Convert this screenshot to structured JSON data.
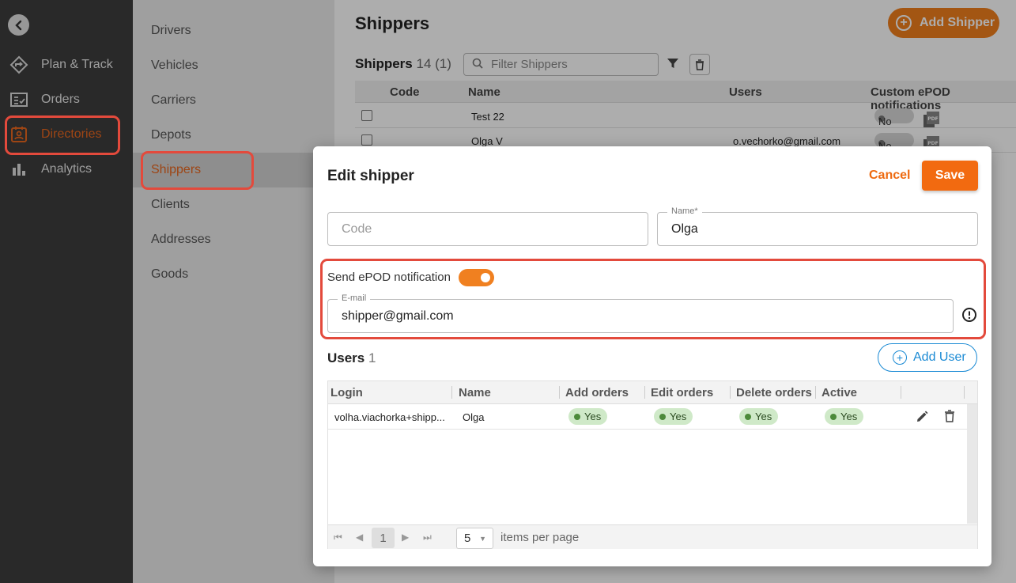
{
  "nav": {
    "items": [
      {
        "label": "Plan & Track",
        "icon": "route-icon"
      },
      {
        "label": "Orders",
        "icon": "orders-icon"
      },
      {
        "label": "Directories",
        "icon": "contacts-icon"
      },
      {
        "label": "Analytics",
        "icon": "bar-chart-icon"
      }
    ]
  },
  "subnav": {
    "items": [
      "Drivers",
      "Vehicles",
      "Carriers",
      "Depots",
      "Shippers",
      "Clients",
      "Addresses",
      "Goods"
    ]
  },
  "main": {
    "title": "Shippers",
    "add_label": "Add Shipper",
    "list_title": "Shippers",
    "list_count": "14 (1)",
    "filter_placeholder": "Filter Shippers",
    "columns": [
      "Code",
      "Name",
      "Users",
      "Custom ePOD notifications"
    ],
    "rows": [
      {
        "code": "",
        "name": "Test 22",
        "users": "",
        "epod": "No",
        "pdf": "PDF"
      },
      {
        "code": "",
        "name": "Olga V",
        "users": "o.vechorko@gmail.com",
        "epod": "No",
        "pdf": "PDF"
      }
    ]
  },
  "modal": {
    "title": "Edit shipper",
    "cancel_label": "Cancel",
    "save_label": "Save",
    "code_placeholder": "Code",
    "name_label": "Name*",
    "name_value": "Olga",
    "epod_label": "Send ePOD notification",
    "epod_on": true,
    "email_label": "E-mail",
    "email_value": "shipper@gmail.com",
    "users_title": "Users",
    "users_count": "1",
    "add_user_label": "Add User",
    "user_columns": [
      "Login",
      "Name",
      "Add orders",
      "Edit orders",
      "Delete orders",
      "Active"
    ],
    "users": [
      {
        "login": "volha.viachorka+shipp...",
        "name": "Olga",
        "add": "Yes",
        "edit": "Yes",
        "delete": "Yes",
        "active": "Yes"
      }
    ],
    "page_current": "1",
    "per_page": "5",
    "per_page_label": "items per page"
  },
  "colors": {
    "accent": "#f26a10",
    "highlight": "#e34a3c",
    "link": "#1a8ad4"
  }
}
